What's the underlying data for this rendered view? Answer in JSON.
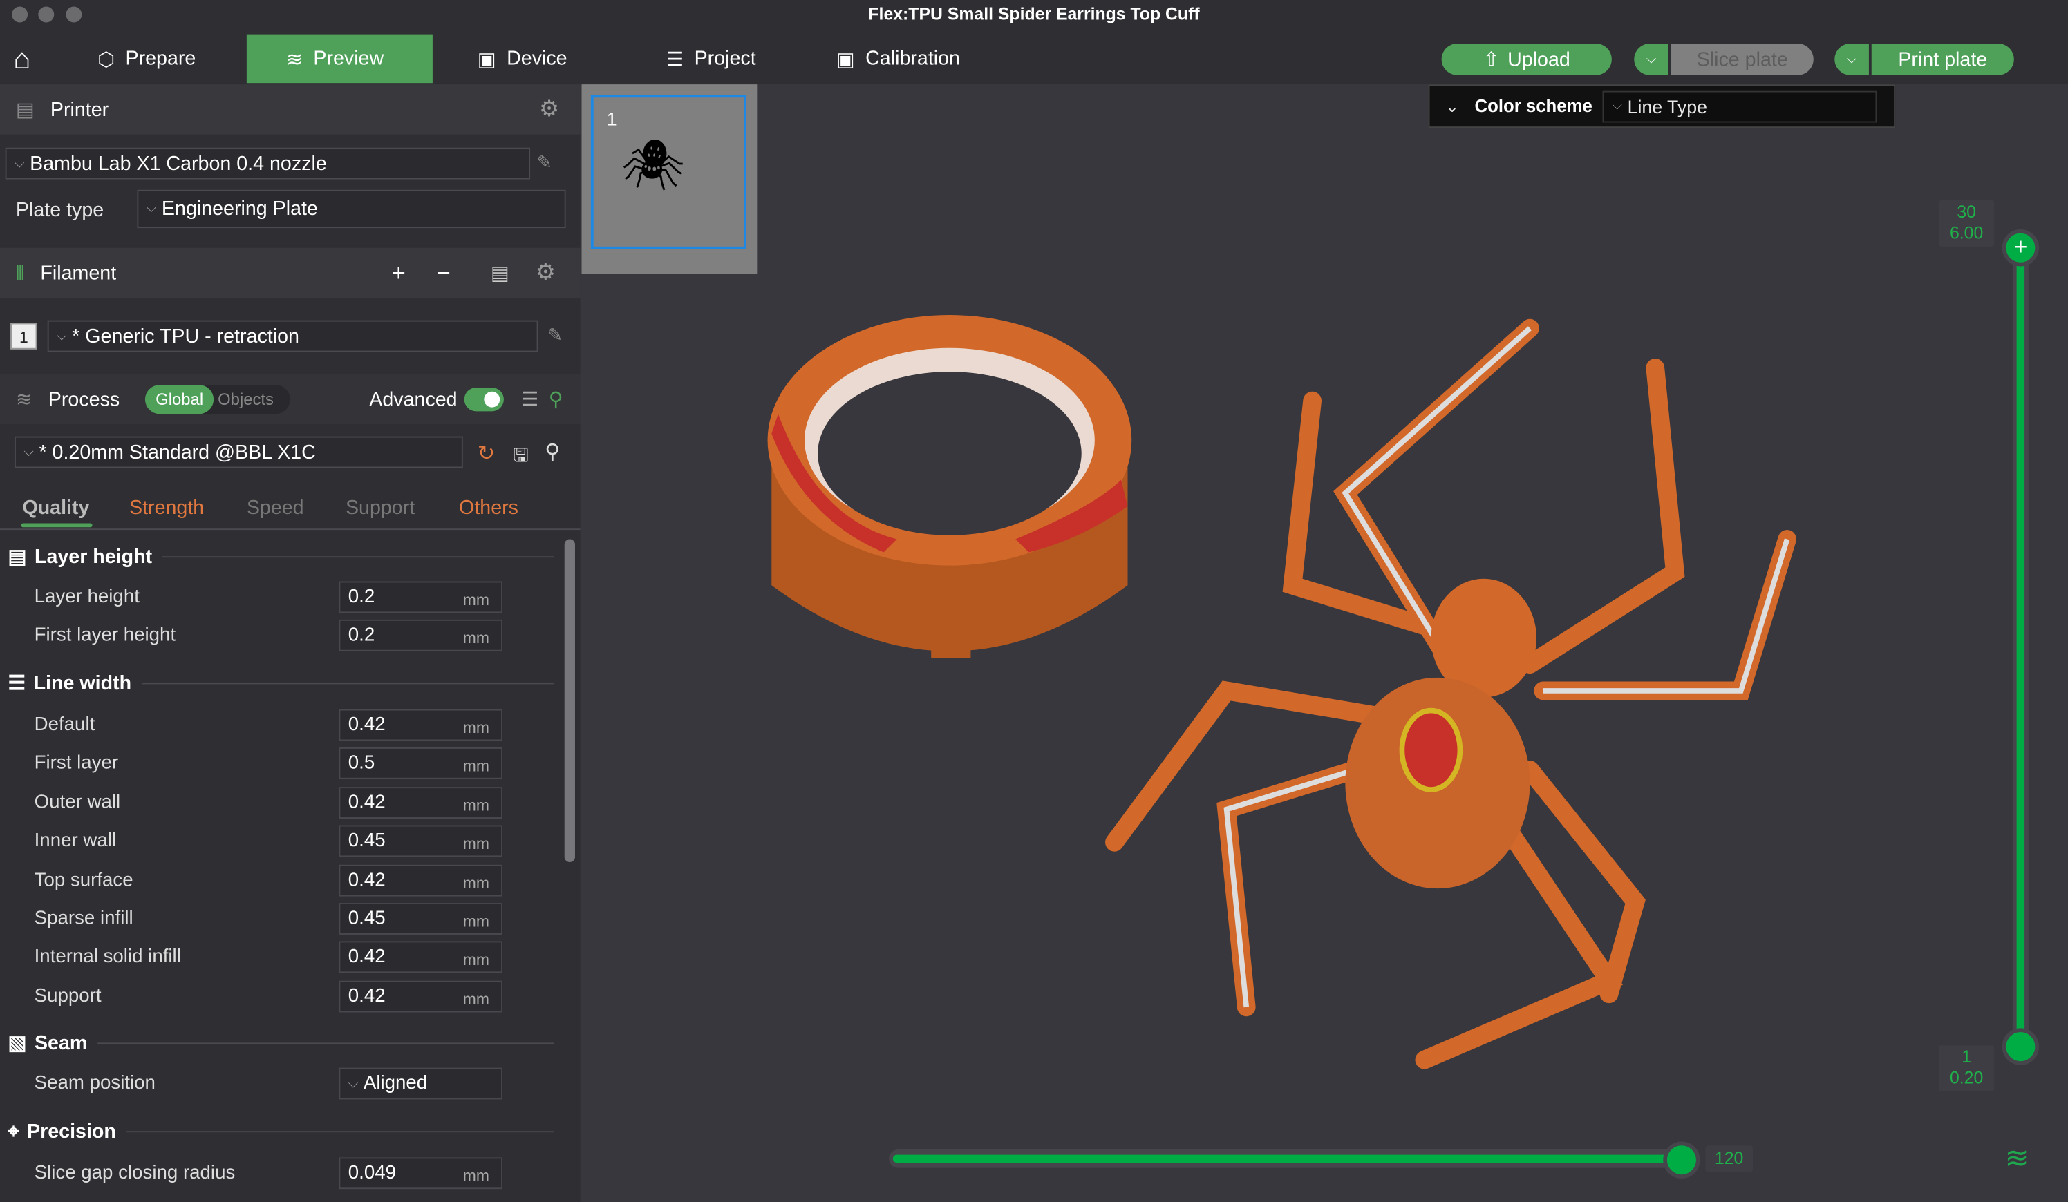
{
  "window": {
    "title": "Flex:TPU Small Spider Earrings Top Cuff"
  },
  "nav": {
    "tabs": [
      {
        "label": "Prepare"
      },
      {
        "label": "Preview"
      },
      {
        "label": "Device"
      },
      {
        "label": "Project"
      },
      {
        "label": "Calibration"
      }
    ],
    "active": "Preview"
  },
  "actions": {
    "upload": "Upload",
    "slice": "Slice plate",
    "print": "Print plate"
  },
  "printer": {
    "header": "Printer",
    "preset": "Bambu Lab X1 Carbon 0.4 nozzle",
    "plate_type_label": "Plate type",
    "plate_type": "Engineering Plate"
  },
  "filament": {
    "header": "Filament",
    "slot": "1",
    "preset": "* Generic TPU - retraction"
  },
  "process": {
    "header": "Process",
    "global": "Global",
    "objects": "Objects",
    "advanced": "Advanced",
    "advanced_on": true,
    "preset": "* 0.20mm Standard @BBL X1C",
    "tabs": [
      {
        "label": "Quality"
      },
      {
        "label": "Strength"
      },
      {
        "label": "Speed"
      },
      {
        "label": "Support"
      },
      {
        "label": "Others"
      }
    ]
  },
  "groups": {
    "layer_height": {
      "title": "Layer height",
      "rows": [
        {
          "label": "Layer height",
          "value": "0.2",
          "unit": "mm"
        },
        {
          "label": "First layer height",
          "value": "0.2",
          "unit": "mm"
        }
      ]
    },
    "line_width": {
      "title": "Line width",
      "rows": [
        {
          "label": "Default",
          "value": "0.42",
          "unit": "mm"
        },
        {
          "label": "First layer",
          "value": "0.5",
          "unit": "mm"
        },
        {
          "label": "Outer wall",
          "value": "0.42",
          "unit": "mm"
        },
        {
          "label": "Inner wall",
          "value": "0.45",
          "unit": "mm"
        },
        {
          "label": "Top surface",
          "value": "0.42",
          "unit": "mm"
        },
        {
          "label": "Sparse infill",
          "value": "0.45",
          "unit": "mm"
        },
        {
          "label": "Internal solid infill",
          "value": "0.42",
          "unit": "mm"
        },
        {
          "label": "Support",
          "value": "0.42",
          "unit": "mm"
        }
      ]
    },
    "seam": {
      "title": "Seam",
      "label": "Seam position",
      "value": "Aligned"
    },
    "precision": {
      "title": "Precision",
      "label": "Slice gap closing radius",
      "value": "0.049",
      "unit": "mm"
    }
  },
  "plate": {
    "number": "1"
  },
  "color_scheme": {
    "label": "Color scheme",
    "value": "Line Type"
  },
  "layer_slider": {
    "top_layer": "30",
    "top_height": "6.00",
    "bottom_layer": "1",
    "bottom_height": "0.20"
  },
  "move_slider": {
    "value": "120",
    "fraction": 1.0
  },
  "colors": {
    "accent": "#4fa15a",
    "slider": "#00ad45",
    "orange": "#e0783f"
  }
}
